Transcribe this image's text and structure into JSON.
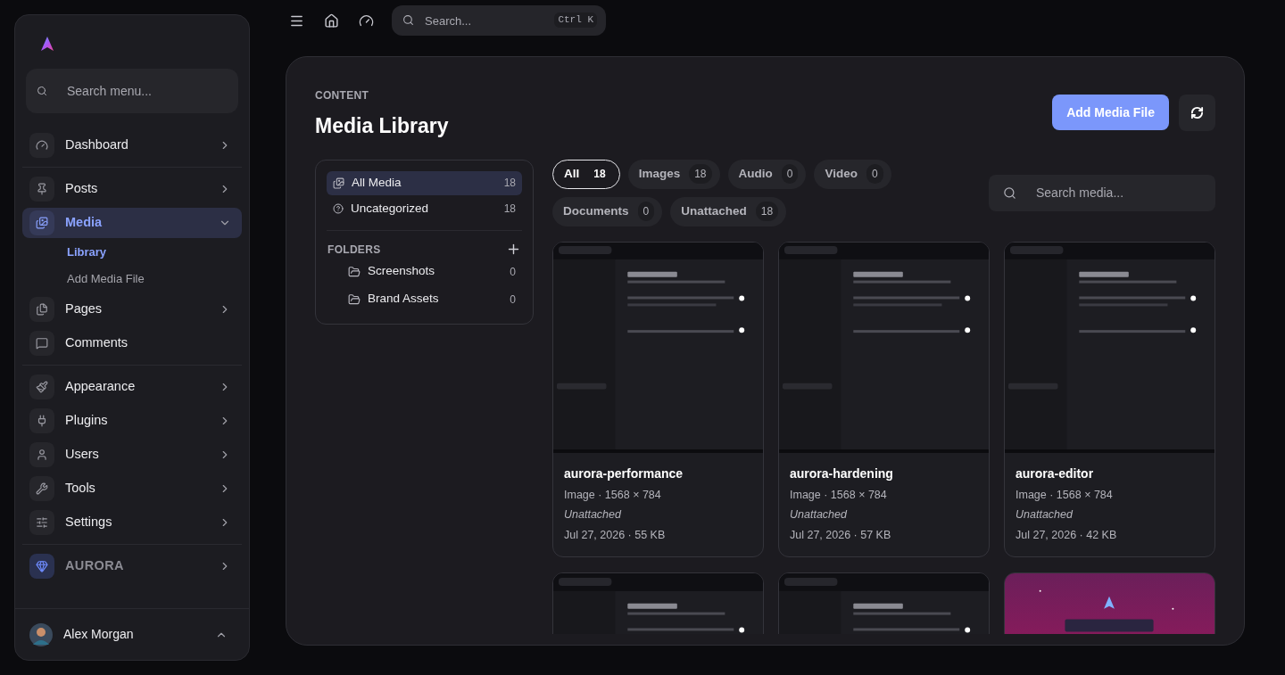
{
  "topbar": {
    "search_placeholder": "Search...",
    "shortcut": "Ctrl K"
  },
  "sidebar": {
    "search_placeholder": "Search menu...",
    "groups": [
      [
        {
          "label": "Dashboard",
          "kind": "nav",
          "expanded": false,
          "selected": false
        }
      ],
      [
        {
          "label": "Posts",
          "kind": "nav",
          "expanded": false,
          "selected": false
        },
        {
          "label": "Media",
          "kind": "nav",
          "expanded": true,
          "selected": true,
          "children": [
            {
              "label": "Library",
              "selected": true
            },
            {
              "label": "Add Media File",
              "selected": false
            }
          ]
        },
        {
          "label": "Pages",
          "kind": "nav",
          "expanded": false,
          "selected": false
        },
        {
          "label": "Comments",
          "kind": "plain",
          "selected": false
        }
      ],
      [
        {
          "label": "Appearance",
          "kind": "nav",
          "expanded": false,
          "selected": false
        },
        {
          "label": "Plugins",
          "kind": "nav",
          "expanded": false,
          "selected": false
        },
        {
          "label": "Users",
          "kind": "nav",
          "expanded": false,
          "selected": false
        },
        {
          "label": "Tools",
          "kind": "nav",
          "expanded": false,
          "selected": false
        },
        {
          "label": "Settings",
          "kind": "nav",
          "expanded": false,
          "selected": false
        }
      ],
      [
        {
          "label": "AURORA",
          "kind": "brand",
          "expanded": false,
          "selected": false
        }
      ]
    ],
    "user": {
      "name": "Alex Morgan"
    }
  },
  "page": {
    "eyebrow": "CONTENT",
    "title": "Media Library",
    "primary_button": "Add Media File"
  },
  "library_nav": {
    "items": [
      {
        "label": "All Media",
        "count": "18",
        "selected": true
      },
      {
        "label": "Uncategorized",
        "count": "18",
        "selected": false
      }
    ],
    "folders_heading": "FOLDERS",
    "folders": [
      {
        "label": "Screenshots",
        "count": "0"
      },
      {
        "label": "Brand Assets",
        "count": "0"
      }
    ]
  },
  "filters": [
    {
      "label": "All",
      "count": "18",
      "selected": true
    },
    {
      "label": "Images",
      "count": "18",
      "selected": false
    },
    {
      "label": "Audio",
      "count": "0",
      "selected": false
    },
    {
      "label": "Video",
      "count": "0",
      "selected": false
    },
    {
      "label": "Documents",
      "count": "0",
      "selected": false
    },
    {
      "label": "Unattached",
      "count": "18",
      "selected": false
    }
  ],
  "media_search_placeholder": "Search media...",
  "cards": [
    {
      "kind": "picture",
      "title": "aurora-performance",
      "meta": "Image · 1568 × 784",
      "status": "Unattached",
      "date_size": "Jul 27, 2026 · 55 KB"
    },
    {
      "kind": "picture",
      "title": "aurora-hardening",
      "meta": "Image · 1568 × 784",
      "status": "Unattached",
      "date_size": "Jul 27, 2026 · 57 KB"
    },
    {
      "kind": "picture",
      "title": "aurora-editor",
      "meta": "Image · 1568 × 784",
      "status": "Unattached",
      "date_size": "Jul 27, 2026 · 42 KB"
    },
    {
      "kind": "picture"
    },
    {
      "kind": "picture"
    },
    {
      "kind": "picture"
    }
  ]
}
